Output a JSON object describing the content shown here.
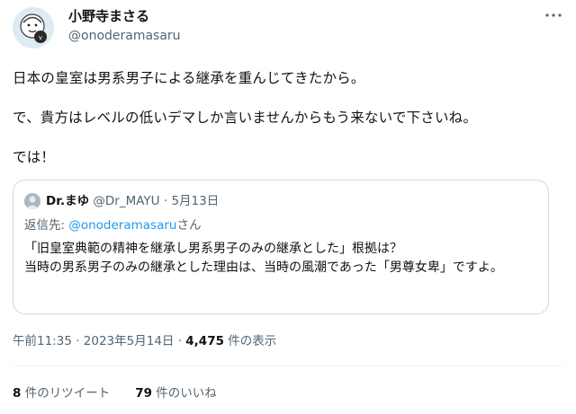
{
  "author": {
    "name": "小野寺まさる",
    "handle": "@onoderamasaru"
  },
  "body": {
    "lines": [
      "日本の皇室は男系男子による継承を重んじてきたから。",
      "で、貴方はレベルの低いデマしか言いませんからもう来ないで下さいね。",
      "では！"
    ]
  },
  "quote": {
    "name": "Dr.まゆ",
    "handle": "@Dr_MAYU",
    "separator": "·",
    "date": "5月13日",
    "reply_prefix": "返信先: ",
    "reply_handle": "@onoderamasaru",
    "reply_suffix": "さん",
    "text_lines": [
      "「旧皇室典範の精神を継承し男系男子のみの継承とした」根拠は？",
      "当時の男系男子のみの継承とした理由は、当時の風潮であった「男尊女卑」ですよ。"
    ]
  },
  "meta": {
    "timestamp": "午前11:35 · 2023年5月14日 · ",
    "views_count": "4,475",
    "views_label": " 件の表示"
  },
  "stats": {
    "retweets_count": "8",
    "retweets_label": " 件のリツイート",
    "likes_count": "79",
    "likes_label": " 件のいいね"
  },
  "icons": {
    "more": "more-dots-icon",
    "avatar": "avatar-illustration",
    "quote_avatar": "default-avatar-icon"
  },
  "colors": {
    "text": "#0f1419",
    "secondary": "#536471",
    "link": "#1d9bf0",
    "border": "#cfd9de"
  }
}
